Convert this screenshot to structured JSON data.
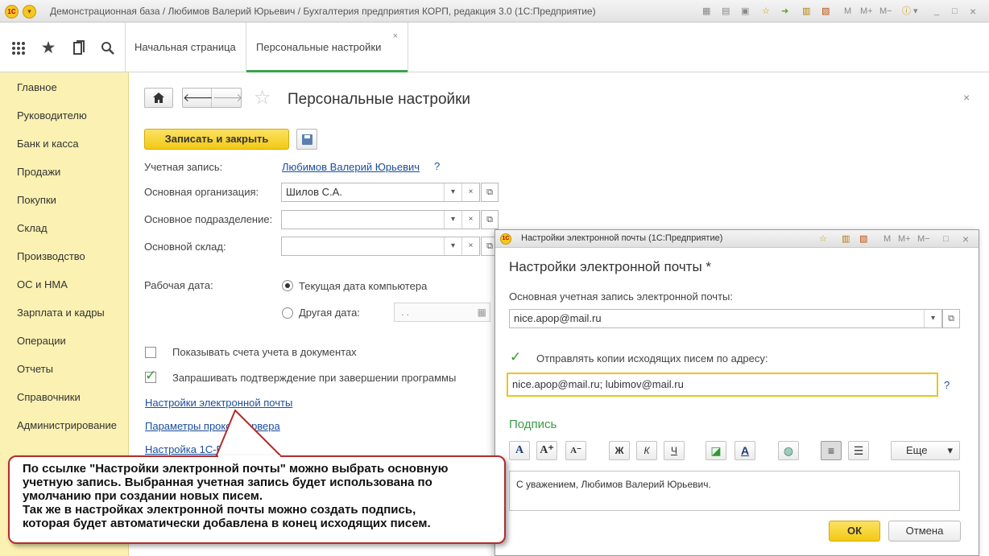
{
  "window": {
    "title": "Демонстрационная база / Любимов Валерий Юрьевич / Бухгалтерия предприятия КОРП, редакция 3.0  (1С:Предприятие)",
    "logo_text": "1С",
    "memory_buttons": [
      "M",
      "M+",
      "M−"
    ],
    "minimize": "_",
    "maximize": "□",
    "close": "×"
  },
  "toolbar": {
    "tabs": [
      {
        "label": "Начальная страница"
      },
      {
        "label": "Персональные настройки",
        "close": "×"
      }
    ]
  },
  "sidebar": {
    "items": [
      {
        "label": "Главное"
      },
      {
        "label": "Руководителю"
      },
      {
        "label": "Банк и касса"
      },
      {
        "label": "Продажи"
      },
      {
        "label": "Покупки"
      },
      {
        "label": "Склад"
      },
      {
        "label": "Производство"
      },
      {
        "label": "ОС и НМА"
      },
      {
        "label": "Зарплата и кадры"
      },
      {
        "label": "Операции"
      },
      {
        "label": "Отчеты"
      },
      {
        "label": "Справочники"
      },
      {
        "label": "Администрирование"
      }
    ]
  },
  "form": {
    "title": "Персональные настройки",
    "close": "×",
    "save_close_label": "Записать и закрыть",
    "account_label": "Учетная запись:",
    "account_value": "Любимов Валерий Юрьевич",
    "help": "?",
    "org_label": "Основная организация:",
    "org_value": "Шилов С.А.",
    "dept_label": "Основное подразделение:",
    "dept_value": "",
    "warehouse_label": "Основной склад:",
    "warehouse_value": "",
    "work_date_label": "Рабочая дата:",
    "radio_current": "Текущая дата компьютера",
    "radio_other": "Другая дата:",
    "date_value": ". .",
    "check_accounts": "Показывать счета учета в документах",
    "check_confirm": "Запрашивать подтверждение при завершении программы",
    "link_email": "Настройки электронной почты",
    "link_proxy": "Параметры прокси-сервера",
    "link_buh": "Настройка 1С-Бухфо"
  },
  "callout": {
    "line1": "По ссылке \"Настройки электронной почты\" можно выбрать основную",
    "line2": "учетную запись. Выбранная учетная запись будет использована по",
    "line3": "умолчанию при создании новых писем.",
    "line4": "Так же в настройках электронной почты можно создать подпись,",
    "line5": "которая будет автоматически добавлена в конец исходящих писем."
  },
  "email_dialog": {
    "window_title": "Настройки электронной почты  (1С:Предприятие)",
    "heading": "Настройки электронной почты *",
    "main_account_label": "Основная учетная запись электронной почты:",
    "main_account_value": "nice.apop@mail.ru",
    "send_copies_label": "Отправлять копии исходящих писем по адресу:",
    "copies_value": "nice.apop@mail.ru; lubimov@mail.ru",
    "help": "?",
    "signature_title": "Подпись",
    "more_label": "Еще",
    "signature_text": "С уважением, Любимов Валерий Юрьевич.",
    "ok_label": "ОК",
    "cancel_label": "Отмена"
  },
  "colors": {
    "sidebar_bg": "#fbf1b2",
    "primary_button": "#f2c914",
    "accent_green": "#3ba24a",
    "link": "#1a4e9c",
    "callout_border": "#b32d2d"
  }
}
